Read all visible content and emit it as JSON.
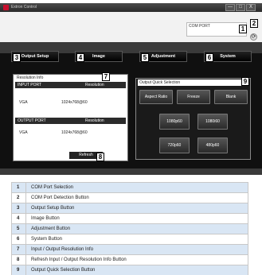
{
  "window": {
    "title": "Extron Control",
    "minimize_label": "—",
    "maximize_label": "□",
    "close_label": "X"
  },
  "com": {
    "label": "COM PORT",
    "value": "",
    "refresh_glyph": "⟳"
  },
  "nav": {
    "output_setup": "Output Setup",
    "image": "Image",
    "adjustment": "Adjustment",
    "system": "System"
  },
  "resolution": {
    "title": "Resolution Info",
    "input_header": "INPUT PORT",
    "output_header": "OUTPUT PORT",
    "resolution_header": "Resolution",
    "input_port": "VGA",
    "input_res": "1024x768@60",
    "output_port": "VGA",
    "output_res": "1024x768@60",
    "refresh_label": "Refresh"
  },
  "quick": {
    "title": "Output Quick Selection",
    "buttons": {
      "aspect_ratio": "Aspect Ratio",
      "freeze": "Freeze",
      "blank": "Blank",
      "r1080p60": "1080p60",
      "r1080i60": "1080i60",
      "r720p60": "720p60",
      "r480p60": "480p60"
    }
  },
  "badges": [
    "1",
    "2",
    "3",
    "4",
    "5",
    "6",
    "7",
    "8",
    "9"
  ],
  "legend": [
    {
      "num": "1",
      "text": "COM Port Selection"
    },
    {
      "num": "2",
      "text": "COM Port Detection Button"
    },
    {
      "num": "3",
      "text": "Output Setup Button"
    },
    {
      "num": "4",
      "text": "Image Button"
    },
    {
      "num": "5",
      "text": "Adjustment Button"
    },
    {
      "num": "6",
      "text": "System Button"
    },
    {
      "num": "7",
      "text": "Input / Output Resolution Info"
    },
    {
      "num": "8",
      "text": "Refresh Input / Output Resolution Info Button"
    },
    {
      "num": "9",
      "text": "Output Quick Selection Button"
    }
  ]
}
